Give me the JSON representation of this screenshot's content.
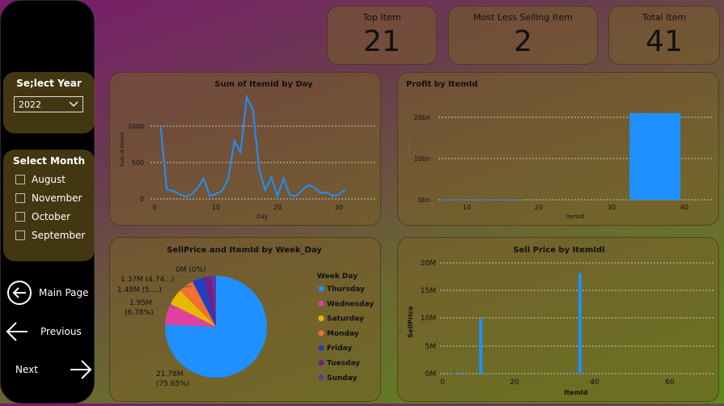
{
  "sidebar": {
    "year_title": "Se;lect Year",
    "year_value": "2022",
    "month_title": "Select Month",
    "months": [
      "August",
      "November",
      "October",
      "September"
    ],
    "nav": {
      "main": "Main Page",
      "previous": "Previous",
      "next": "Next"
    }
  },
  "kpis": [
    {
      "label": "Top Item",
      "value": "21"
    },
    {
      "label": "Most Less Selling Item",
      "value": "2"
    },
    {
      "label": "Total Item",
      "value": "41"
    }
  ],
  "colors": {
    "series": "#1e90ff",
    "grid": "#c8c8a0"
  },
  "charts": {
    "sum_by_day": {
      "title": "Sum of ItemId by Day",
      "xlabel": "Day",
      "ylabel": "Sum of ItemId",
      "xticks": [
        "0",
        "10",
        "20",
        "30"
      ],
      "yticks": [
        "0",
        "500",
        "1000"
      ]
    },
    "profit": {
      "title": "Profit by ItemId",
      "xlabel": "ItemId",
      "ylabel": "Profit",
      "xticks": [
        "10",
        "20",
        "30",
        "40"
      ],
      "yticks": [
        "0bn",
        "10bn",
        "20bn"
      ]
    },
    "pie": {
      "title": "SellPrice and ItemId by Week_Day",
      "legend_title": "Week Day",
      "labels": {
        "big": [
          "21.78M",
          "(75.65%)"
        ],
        "l195": [
          "1.95M",
          "(6.78%)"
        ],
        "l148": "1.48M (5....)",
        "l137": "1.37M (4.74...)",
        "l0": "0M (0%)"
      }
    },
    "sell_price": {
      "title": "Sell Price by ItemIdl",
      "xlabel": "ItemId",
      "ylabel": "SellPrice",
      "xticks": [
        "0",
        "20",
        "40",
        "60"
      ],
      "yticks": [
        "0M",
        "5M",
        "10M",
        "15M",
        "20M"
      ]
    }
  },
  "chart_data": [
    {
      "type": "line",
      "title": "Sum of ItemId by Day",
      "xlabel": "Day",
      "ylabel": "Sum of ItemId",
      "xlim": [
        0,
        32
      ],
      "ylim": [
        0,
        1400
      ],
      "x": [
        1,
        2,
        3,
        4,
        5,
        6,
        7,
        8,
        9,
        10,
        11,
        12,
        13,
        14,
        15,
        16,
        17,
        18,
        19,
        20,
        21,
        22,
        23,
        24,
        25,
        26,
        27,
        28,
        29,
        30,
        31
      ],
      "y": [
        1000,
        130,
        110,
        70,
        30,
        60,
        150,
        280,
        40,
        70,
        110,
        280,
        800,
        640,
        1400,
        1230,
        420,
        120,
        300,
        40,
        280,
        50,
        40,
        120,
        190,
        160,
        80,
        90,
        40,
        60,
        130
      ]
    },
    {
      "type": "bar",
      "title": "Profit by ItemId",
      "xlabel": "ItemId",
      "ylabel": "Profit",
      "x": [
        7,
        8,
        9,
        10,
        11,
        12,
        13,
        14,
        15,
        16,
        17,
        33,
        34,
        35,
        36,
        37,
        38,
        39
      ],
      "values": [
        0.1,
        0.1,
        0.1,
        0.1,
        0.1,
        0.1,
        0.1,
        0.1,
        0.1,
        0.1,
        0.1,
        21,
        21,
        21,
        21,
        21,
        21,
        21
      ],
      "unit": "bn",
      "ylim": [
        0,
        25
      ]
    },
    {
      "type": "pie",
      "title": "SellPrice and ItemId by Week_Day",
      "categories": [
        "Thursday",
        "Wednesday",
        "Saturday",
        "Monday",
        "Friday",
        "Tuesday",
        "Sunday"
      ],
      "values": [
        21.78,
        1.95,
        1.48,
        1.37,
        1.1,
        0.7,
        0.4
      ],
      "colors": [
        "#1e90ff",
        "#e040a0",
        "#e6b800",
        "#f07030",
        "#2040c0",
        "#7a1a8a",
        "#5a3a9a"
      ]
    },
    {
      "type": "bar",
      "title": "Sell Price by ItemIdl",
      "xlabel": "ItemId",
      "ylabel": "SellPrice",
      "x": [
        3,
        5,
        6,
        10,
        12,
        35,
        36,
        38
      ],
      "values": [
        0.05,
        0.2,
        0.1,
        10,
        0.1,
        0.2,
        18.2,
        0.1
      ],
      "unit": "M",
      "ylim": [
        0,
        22
      ]
    }
  ]
}
